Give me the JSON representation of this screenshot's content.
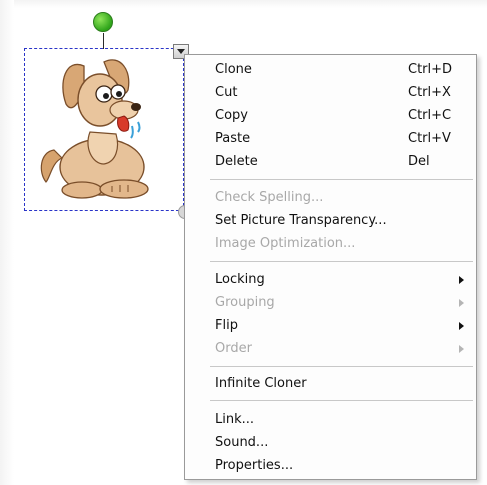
{
  "context_menu": {
    "group_edit": [
      {
        "label": "Clone",
        "shortcut": "Ctrl+D"
      },
      {
        "label": "Cut",
        "shortcut": "Ctrl+X"
      },
      {
        "label": "Copy",
        "shortcut": "Ctrl+C"
      },
      {
        "label": "Paste",
        "shortcut": "Ctrl+V"
      },
      {
        "label": "Delete",
        "shortcut": "Del"
      }
    ],
    "group_tools": [
      {
        "label": "Check Spelling...",
        "enabled": false
      },
      {
        "label": "Set Picture Transparency...",
        "enabled": true
      },
      {
        "label": "Image Optimization...",
        "enabled": false
      }
    ],
    "group_submenus": [
      {
        "label": "Locking",
        "enabled": true
      },
      {
        "label": "Grouping",
        "enabled": false
      },
      {
        "label": "Flip",
        "enabled": true
      },
      {
        "label": "Order",
        "enabled": false
      }
    ],
    "group_cloner": [
      {
        "label": "Infinite Cloner"
      }
    ],
    "group_properties": [
      {
        "label": "Link..."
      },
      {
        "label": "Sound..."
      },
      {
        "label": "Properties..."
      }
    ]
  },
  "icons": {
    "rotate_handle": "rotate-handle-icon",
    "menu_handle": "chevron-down-icon",
    "resize_handle": "resize-handle-icon",
    "submenu_arrow": "chevron-right-icon"
  },
  "colors": {
    "selection_border": "#2a34c8",
    "rotate_handle": "#2fa41a",
    "disabled_text": "#a8a8a8"
  }
}
